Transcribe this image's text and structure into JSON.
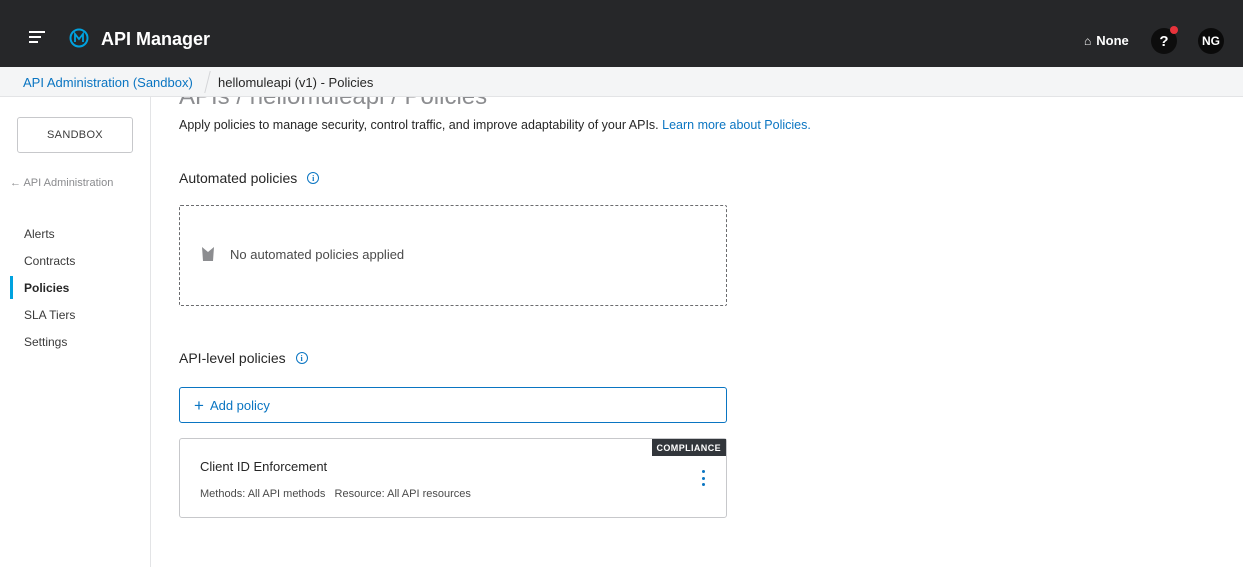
{
  "header": {
    "app_title": "API Manager",
    "environment_label": "None",
    "help_label": "?",
    "avatar_initials": "NG",
    "colors": {
      "bar": "#262729",
      "logo": "#00a2df",
      "notification": "#e8333b"
    }
  },
  "breadcrumb": {
    "parent": "API Administration (Sandbox)",
    "current": "hellomuleapi (v1) - Policies"
  },
  "sidebar": {
    "environment_button": "SANDBOX",
    "back_link": "← API Administration",
    "items": [
      {
        "label": "Alerts",
        "active": false
      },
      {
        "label": "Contracts",
        "active": false
      },
      {
        "label": "Policies",
        "active": true
      },
      {
        "label": "SLA Tiers",
        "active": false
      },
      {
        "label": "Settings",
        "active": false
      }
    ]
  },
  "main": {
    "heading": "APIs / hellomuleapi / Policies",
    "intro_text": "Apply policies to manage security, control traffic, and improve adaptability of your APIs.",
    "intro_link": "Learn more about Policies.",
    "automated_title": "Automated policies",
    "automated_empty": "No automated policies applied",
    "api_level_title": "API-level policies",
    "add_policy_label": "Add policy",
    "policies": [
      {
        "name": "Client ID Enforcement",
        "badge": "COMPLIANCE",
        "methods": "Methods: All API methods",
        "resource": "Resource: All API resources"
      }
    ]
  }
}
